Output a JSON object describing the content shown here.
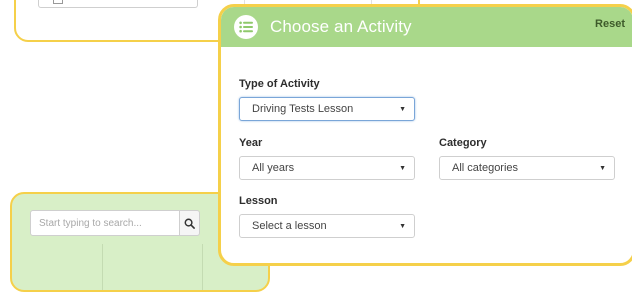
{
  "background_top": {},
  "background_bottom": {
    "search_placeholder": "Start typing to search...",
    "search_icon": "search-icon"
  },
  "modal": {
    "header_icon": "list-icon",
    "title": "Choose an Activity",
    "reset_label": "Reset",
    "type_label": "Type of Activity",
    "type_value": "Driving Tests Lesson",
    "year_label": "Year",
    "year_value": "All years",
    "category_label": "Category",
    "category_value": "All categories",
    "lesson_label": "Lesson",
    "lesson_value": "Select a lesson"
  },
  "colors": {
    "accent_border": "#f5d04a",
    "header_green": "#a9d88a",
    "bg_panel_green": "#d8efc7"
  }
}
